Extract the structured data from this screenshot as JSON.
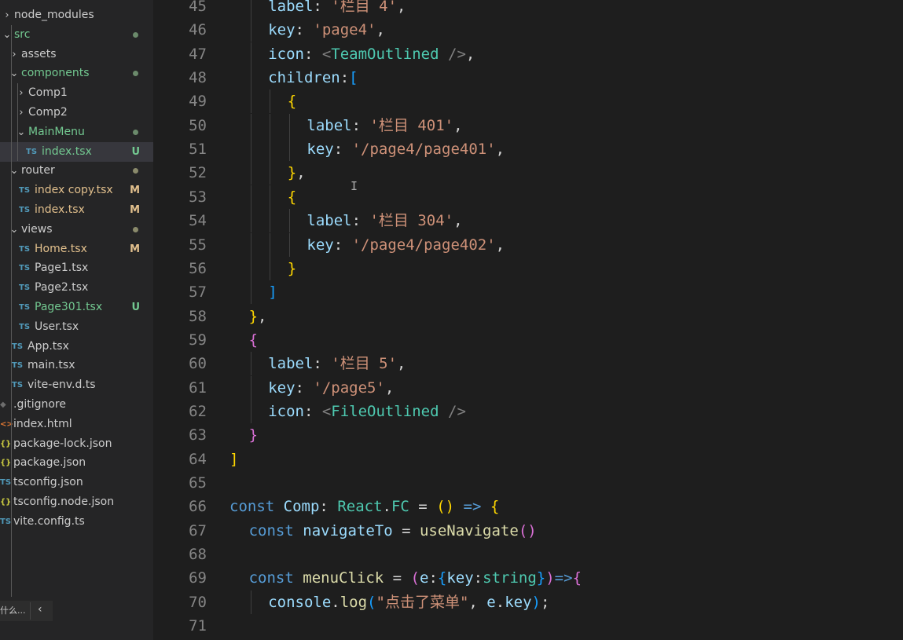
{
  "explorer": {
    "items": [
      {
        "name": "node_modules",
        "chevron": "›",
        "icon": "",
        "icon_color": "",
        "color": "#cccccc",
        "status": "",
        "dot": ""
      },
      {
        "name": "src",
        "chevron": "⌄",
        "icon": "",
        "icon_color": "",
        "color": "#73c991",
        "status": "",
        "dot": "#6b8a6b"
      },
      {
        "name": "assets",
        "chevron": "›",
        "icon": "",
        "icon_color": "",
        "color": "#cccccc",
        "status": "",
        "dot": ""
      },
      {
        "name": "components",
        "chevron": "⌄",
        "icon": "",
        "icon_color": "",
        "color": "#73c991",
        "status": "",
        "dot": "#6b8a6b"
      },
      {
        "name": "Comp1",
        "chevron": "›",
        "icon": "",
        "icon_color": "",
        "color": "#cccccc",
        "status": "",
        "dot": ""
      },
      {
        "name": "Comp2",
        "chevron": "›",
        "icon": "",
        "icon_color": "",
        "color": "#cccccc",
        "status": "",
        "dot": ""
      },
      {
        "name": "MainMenu",
        "chevron": "⌄",
        "icon": "",
        "icon_color": "",
        "color": "#73c991",
        "status": "",
        "dot": "#6b8a6b"
      },
      {
        "name": "index.tsx",
        "chevron": "",
        "icon": "TS",
        "icon_color": "#519aba",
        "color": "#73c991",
        "status": "U",
        "status_color": "#73c991",
        "dot": "",
        "selected": true
      },
      {
        "name": "router",
        "chevron": "⌄",
        "icon": "",
        "icon_color": "",
        "color": "#cccccc",
        "status": "",
        "dot": "#8a8a6b"
      },
      {
        "name": "index copy.tsx",
        "chevron": "",
        "icon": "TS",
        "icon_color": "#519aba",
        "color": "#e2c08d",
        "status": "M",
        "status_color": "#e2c08d",
        "dot": ""
      },
      {
        "name": "index.tsx",
        "chevron": "",
        "icon": "TS",
        "icon_color": "#519aba",
        "color": "#e2c08d",
        "status": "M",
        "status_color": "#e2c08d",
        "dot": ""
      },
      {
        "name": "views",
        "chevron": "⌄",
        "icon": "",
        "icon_color": "",
        "color": "#cccccc",
        "status": "",
        "dot": "#8a8a6b"
      },
      {
        "name": "Home.tsx",
        "chevron": "",
        "icon": "TS",
        "icon_color": "#519aba",
        "color": "#e2c08d",
        "status": "M",
        "status_color": "#e2c08d",
        "dot": ""
      },
      {
        "name": "Page1.tsx",
        "chevron": "",
        "icon": "TS",
        "icon_color": "#519aba",
        "color": "#cccccc",
        "status": "",
        "dot": ""
      },
      {
        "name": "Page2.tsx",
        "chevron": "",
        "icon": "TS",
        "icon_color": "#519aba",
        "color": "#cccccc",
        "status": "",
        "dot": ""
      },
      {
        "name": "Page301.tsx",
        "chevron": "",
        "icon": "TS",
        "icon_color": "#519aba",
        "color": "#73c991",
        "status": "U",
        "status_color": "#73c991",
        "dot": ""
      },
      {
        "name": "User.tsx",
        "chevron": "",
        "icon": "TS",
        "icon_color": "#519aba",
        "color": "#cccccc",
        "status": "",
        "dot": ""
      },
      {
        "name": "App.tsx",
        "chevron": "",
        "icon": "TS",
        "icon_color": "#519aba",
        "color": "#cccccc",
        "status": "",
        "dot": ""
      },
      {
        "name": "main.tsx",
        "chevron": "",
        "icon": "TS",
        "icon_color": "#519aba",
        "color": "#cccccc",
        "status": "",
        "dot": ""
      },
      {
        "name": "vite-env.d.ts",
        "chevron": "",
        "icon": "TS",
        "icon_color": "#519aba",
        "color": "#cccccc",
        "status": "",
        "dot": ""
      },
      {
        "name": ".gitignore",
        "chevron": "",
        "icon": "◆",
        "icon_color": "#6d6d6d",
        "color": "#cccccc",
        "status": "",
        "dot": ""
      },
      {
        "name": "index.html",
        "chevron": "",
        "icon": "<>",
        "icon_color": "#e37933",
        "color": "#cccccc",
        "status": "",
        "dot": ""
      },
      {
        "name": "package-lock.json",
        "chevron": "",
        "icon": "{}",
        "icon_color": "#cbcb41",
        "color": "#cccccc",
        "status": "",
        "dot": ""
      },
      {
        "name": "package.json",
        "chevron": "",
        "icon": "{}",
        "icon_color": "#cbcb41",
        "color": "#cccccc",
        "status": "",
        "dot": ""
      },
      {
        "name": "tsconfig.json",
        "chevron": "",
        "icon": "TS",
        "icon_color": "#519aba",
        "color": "#cccccc",
        "status": "",
        "dot": ""
      },
      {
        "name": "tsconfig.node.json",
        "chevron": "",
        "icon": "{}",
        "icon_color": "#cbcb41",
        "color": "#cccccc",
        "status": "",
        "dot": ""
      },
      {
        "name": "vite.config.ts",
        "chevron": "",
        "icon": "TS",
        "icon_color": "#519aba",
        "color": "#cccccc",
        "status": "",
        "dot": ""
      }
    ]
  },
  "outline": {
    "text": "什么...",
    "chevron": "‹"
  },
  "syntax_colors": {
    "p": "#d4d4d4",
    "k": "#9cdcfe",
    "s": "#ce9178",
    "t": "#4ec9b0",
    "f": "#dcdcaa",
    "b": "#569cd6",
    "b1": "#ffd700",
    "b2": "#da70d6",
    "b3": "#179fff",
    "dim": "#808080"
  },
  "code_lines": [
    {
      "n": "45",
      "tokens": [
        [
          "k",
          "label"
        ],
        [
          "p",
          ": "
        ],
        [
          "s",
          "'栏目 4'"
        ],
        [
          "p",
          ","
        ]
      ]
    },
    {
      "n": "46",
      "tokens": [
        [
          "k",
          "key"
        ],
        [
          "p",
          ": "
        ],
        [
          "s",
          "'page4'"
        ],
        [
          "p",
          ","
        ]
      ]
    },
    {
      "n": "47",
      "tokens": [
        [
          "k",
          "icon"
        ],
        [
          "p",
          ": "
        ],
        [
          "dim",
          "<"
        ],
        [
          "t",
          "TeamOutlined"
        ],
        [
          "p",
          " "
        ],
        [
          "dim",
          "/>"
        ],
        [
          "p",
          ","
        ]
      ]
    },
    {
      "n": "48",
      "tokens": [
        [
          "k",
          "children"
        ],
        [
          "p",
          ":"
        ],
        [
          "b3",
          "["
        ]
      ]
    },
    {
      "n": "49",
      "tokens": [
        [
          "b1",
          "{"
        ]
      ]
    },
    {
      "n": "50",
      "tokens": [
        [
          "k",
          "label"
        ],
        [
          "p",
          ": "
        ],
        [
          "s",
          "'栏目 401'"
        ],
        [
          "p",
          ","
        ]
      ]
    },
    {
      "n": "51",
      "tokens": [
        [
          "k",
          "key"
        ],
        [
          "p",
          ": "
        ],
        [
          "s",
          "'/page4/page401'"
        ],
        [
          "p",
          ","
        ]
      ]
    },
    {
      "n": "52",
      "tokens": [
        [
          "b1",
          "}"
        ],
        [
          "p",
          ","
        ]
      ]
    },
    {
      "n": "53",
      "tokens": [
        [
          "b1",
          "{"
        ]
      ]
    },
    {
      "n": "54",
      "tokens": [
        [
          "k",
          "label"
        ],
        [
          "p",
          ": "
        ],
        [
          "s",
          "'栏目 304'"
        ],
        [
          "p",
          ","
        ]
      ]
    },
    {
      "n": "55",
      "tokens": [
        [
          "k",
          "key"
        ],
        [
          "p",
          ": "
        ],
        [
          "s",
          "'/page4/page402'"
        ],
        [
          "p",
          ","
        ]
      ]
    },
    {
      "n": "56",
      "tokens": [
        [
          "b1",
          "}"
        ]
      ]
    },
    {
      "n": "57",
      "tokens": [
        [
          "b3",
          "]"
        ]
      ]
    },
    {
      "n": "58",
      "tokens": [
        [
          "b1",
          "}"
        ],
        [
          "p",
          ","
        ]
      ]
    },
    {
      "n": "59",
      "tokens": [
        [
          "b2",
          "{"
        ]
      ]
    },
    {
      "n": "60",
      "tokens": [
        [
          "k",
          "label"
        ],
        [
          "p",
          ": "
        ],
        [
          "s",
          "'栏目 5'"
        ],
        [
          "p",
          ","
        ]
      ]
    },
    {
      "n": "61",
      "tokens": [
        [
          "k",
          "key"
        ],
        [
          "p",
          ": "
        ],
        [
          "s",
          "'/page5'"
        ],
        [
          "p",
          ","
        ]
      ]
    },
    {
      "n": "62",
      "tokens": [
        [
          "k",
          "icon"
        ],
        [
          "p",
          ": "
        ],
        [
          "dim",
          "<"
        ],
        [
          "t",
          "FileOutlined"
        ],
        [
          "p",
          " "
        ],
        [
          "dim",
          "/>"
        ]
      ]
    },
    {
      "n": "63",
      "tokens": [
        [
          "b2",
          "}"
        ]
      ]
    },
    {
      "n": "64",
      "tokens": [
        [
          "b1",
          "]"
        ]
      ]
    },
    {
      "n": "65",
      "tokens": []
    },
    {
      "n": "66",
      "tokens": [
        [
          "b",
          "const"
        ],
        [
          "p",
          " "
        ],
        [
          "k",
          "Comp"
        ],
        [
          "p",
          ": "
        ],
        [
          "t",
          "React"
        ],
        [
          "p",
          "."
        ],
        [
          "t",
          "FC"
        ],
        [
          "p",
          " = "
        ],
        [
          "b1",
          "()"
        ],
        [
          "p",
          " "
        ],
        [
          "b",
          "=>"
        ],
        [
          "p",
          " "
        ],
        [
          "b1",
          "{"
        ]
      ]
    },
    {
      "n": "67",
      "tokens": [
        [
          "b",
          "const"
        ],
        [
          "p",
          " "
        ],
        [
          "k",
          "navigateTo"
        ],
        [
          "p",
          " = "
        ],
        [
          "f",
          "useNavigate"
        ],
        [
          "b2",
          "()"
        ]
      ]
    },
    {
      "n": "68",
      "tokens": []
    },
    {
      "n": "69",
      "tokens": [
        [
          "b",
          "const"
        ],
        [
          "p",
          " "
        ],
        [
          "f",
          "menuClick"
        ],
        [
          "p",
          " = "
        ],
        [
          "b2",
          "("
        ],
        [
          "k",
          "e"
        ],
        [
          "p",
          ":"
        ],
        [
          "b3",
          "{"
        ],
        [
          "k",
          "key"
        ],
        [
          "p",
          ":"
        ],
        [
          "t",
          "string"
        ],
        [
          "b3",
          "}"
        ],
        [
          "b2",
          ")"
        ],
        [
          "b",
          "=>"
        ],
        [
          "b2",
          "{"
        ]
      ]
    },
    {
      "n": "70",
      "tokens": [
        [
          "k",
          "console"
        ],
        [
          "p",
          "."
        ],
        [
          "f",
          "log"
        ],
        [
          "b3",
          "("
        ],
        [
          "s",
          "\"点击了菜单\""
        ],
        [
          "p",
          ", "
        ],
        [
          "k",
          "e"
        ],
        [
          "p",
          "."
        ],
        [
          "k",
          "key"
        ],
        [
          "b3",
          ")"
        ],
        [
          "p",
          ";"
        ]
      ]
    },
    {
      "n": "71",
      "tokens": []
    }
  ]
}
